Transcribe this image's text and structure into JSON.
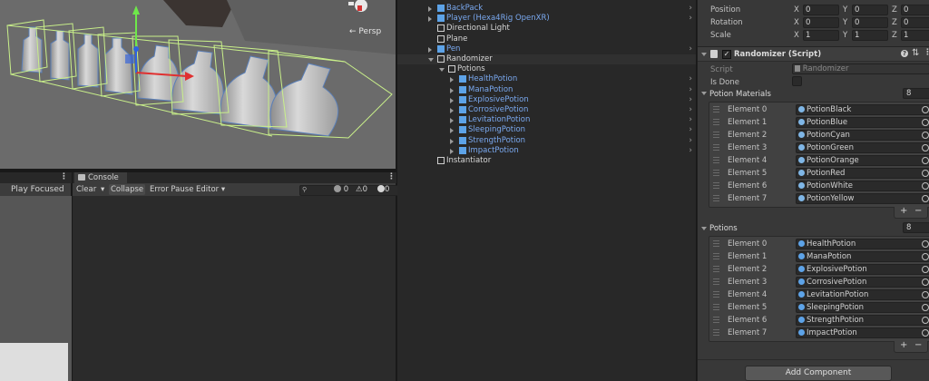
{
  "scene": {
    "persp_label": "Persp",
    "gizmo_icon": "scene-gizmo-icon"
  },
  "game": {
    "play_focused": "Play Focused"
  },
  "console": {
    "tab_label": "Console",
    "clear_label": "Clear",
    "collapse_label": "Collapse",
    "error_pause_label": "Error Pause",
    "editor_label": "Editor",
    "search_placeholder": "",
    "log_count": "0",
    "warning_count": "0",
    "error_count": "0"
  },
  "hierarchy": {
    "partial_top": "...",
    "items": [
      {
        "label": "BackPack",
        "color": "blue"
      },
      {
        "label": "Player (Hexa4Rig OpenXR)",
        "color": "blue"
      },
      {
        "label": "Directional Light",
        "color": "white"
      },
      {
        "label": "Plane",
        "color": "white"
      },
      {
        "label": "Pen",
        "color": "blue"
      },
      {
        "label": "Randomizer",
        "color": "white"
      },
      {
        "label": "Potions",
        "color": "white"
      },
      {
        "label": "HealthPotion",
        "color": "blue"
      },
      {
        "label": "ManaPotion",
        "color": "blue"
      },
      {
        "label": "ExplosivePotion",
        "color": "blue"
      },
      {
        "label": "CorrosivePotion",
        "color": "blue"
      },
      {
        "label": "LevitationPotion",
        "color": "blue"
      },
      {
        "label": "SleepingPotion",
        "color": "blue"
      },
      {
        "label": "StrengthPotion",
        "color": "blue"
      },
      {
        "label": "ImpactPotion",
        "color": "blue"
      },
      {
        "label": "Instantiator",
        "color": "white"
      }
    ]
  },
  "inspector": {
    "transform": {
      "position_label": "Position",
      "rotation_label": "Rotation",
      "scale_label": "Scale",
      "position": {
        "x": "0",
        "y": "0",
        "z": "0"
      },
      "rotation": {
        "x": "0",
        "y": "0",
        "z": "0"
      },
      "scale": {
        "x": "1",
        "y": "1",
        "z": "1"
      }
    },
    "component_title": "Randomizer (Script)",
    "script_label": "Script",
    "script_value": "Randomizer",
    "is_done_label": "Is Done",
    "potion_materials_label": "Potion Materials",
    "potion_materials_count": "8",
    "potion_materials": [
      {
        "label": "Element 0",
        "value": "PotionBlack"
      },
      {
        "label": "Element 1",
        "value": "PotionBlue"
      },
      {
        "label": "Element 2",
        "value": "PotionCyan"
      },
      {
        "label": "Element 3",
        "value": "PotionGreen"
      },
      {
        "label": "Element 4",
        "value": "PotionOrange"
      },
      {
        "label": "Element 5",
        "value": "PotionRed"
      },
      {
        "label": "Element 6",
        "value": "PotionWhite"
      },
      {
        "label": "Element 7",
        "value": "PotionYellow"
      }
    ],
    "potions_label": "Potions",
    "potions_count": "8",
    "potions": [
      {
        "label": "Element 0",
        "value": "HealthPotion"
      },
      {
        "label": "Element 1",
        "value": "ManaPotion"
      },
      {
        "label": "Element 2",
        "value": "ExplosivePotion"
      },
      {
        "label": "Element 3",
        "value": "CorrosivePotion"
      },
      {
        "label": "Element 4",
        "value": "LevitationPotion"
      },
      {
        "label": "Element 5",
        "value": "SleepingPotion"
      },
      {
        "label": "Element 6",
        "value": "StrengthPotion"
      },
      {
        "label": "Element 7",
        "value": "ImpactPotion"
      }
    ],
    "add_component": "Add Component"
  },
  "colors": {
    "accent_blue": "#7aa9f0",
    "panel_bg": "#383838",
    "hierarchy_bg": "#282828"
  }
}
